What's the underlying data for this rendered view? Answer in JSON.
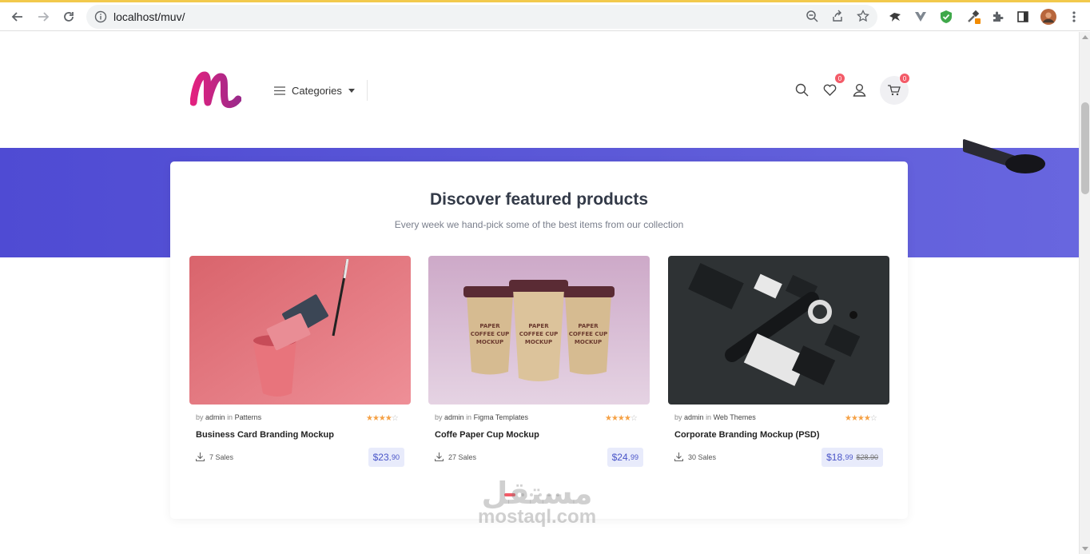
{
  "browser": {
    "url": "localhost/muv/"
  },
  "header": {
    "categories_label": "Categories",
    "wishlist_count": "0",
    "cart_count": "0"
  },
  "featured": {
    "title": "Discover featured products",
    "subtitle": "Every week we hand-pick some of the best items from our collection"
  },
  "products": [
    {
      "by_label": "by",
      "author": "admin",
      "in_label": "in",
      "category": "Patterns",
      "rating": 4,
      "name": "Business Card Branding Mockup",
      "sales": "7 Sales",
      "price_main": "$23.",
      "price_cents": "90",
      "old_price": ""
    },
    {
      "by_label": "by",
      "author": "admin",
      "in_label": "in",
      "category": "Figma Templates",
      "rating": 4,
      "name": "Coffe Paper Cup Mockup",
      "sales": "27 Sales",
      "price_main": "$24.",
      "price_cents": "99",
      "old_price": ""
    },
    {
      "by_label": "by",
      "author": "admin",
      "in_label": "in",
      "category": "Web Themes",
      "rating": 4,
      "name": "Corporate Branding Mockup (PSD)",
      "sales": "30 Sales",
      "price_main": "$18.",
      "price_cents": "99",
      "old_price": "$28.90"
    }
  ],
  "watermark": {
    "arabic": "مستقل",
    "latin": "mostaql.com"
  },
  "colors": {
    "accent": "#f35b68",
    "hero": "#5552d6",
    "price_bg": "#e8ebfb",
    "price_text": "#4a55c8",
    "star": "#f5a145",
    "logo": "#e2217f"
  }
}
